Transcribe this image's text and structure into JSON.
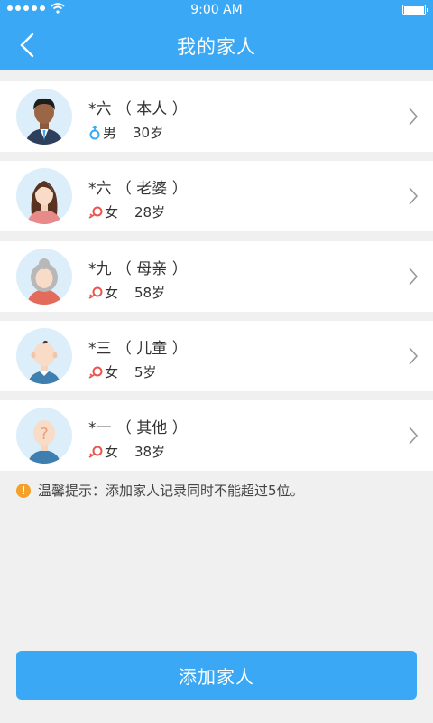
{
  "status_bar": {
    "time": "9:00 AM"
  },
  "header": {
    "title": "我的家人",
    "back_icon": "back-arrow-icon"
  },
  "members": [
    {
      "name": "*六 （ 本人 ）",
      "gender": "男",
      "age": "30岁",
      "gender_icon": "male-icon",
      "avatar": "man-avatar"
    },
    {
      "name": "*六 （ 老婆 ）",
      "gender": "女",
      "age": "28岁",
      "gender_icon": "female-icon",
      "avatar": "woman-avatar"
    },
    {
      "name": "*九 （ 母亲 ）",
      "gender": "女",
      "age": "58岁",
      "gender_icon": "female-icon",
      "avatar": "elder-woman-avatar"
    },
    {
      "name": "*三 （ 儿童 ）",
      "gender": "女",
      "age": "5岁",
      "gender_icon": "female-icon",
      "avatar": "child-avatar"
    },
    {
      "name": "*一 （ 其他 ）",
      "gender": "女",
      "age": "38岁",
      "gender_icon": "female-icon",
      "avatar": "unknown-person-avatar"
    }
  ],
  "tip": {
    "icon": "warning-icon",
    "text": "温馨提示：添加家人记录同时不能超过5位。"
  },
  "footer": {
    "add_label": "添加家人"
  },
  "colors": {
    "primary": "#3aa8f4",
    "male": "#3aa8f4",
    "female": "#e8554e",
    "warning": "#f4a12a"
  }
}
